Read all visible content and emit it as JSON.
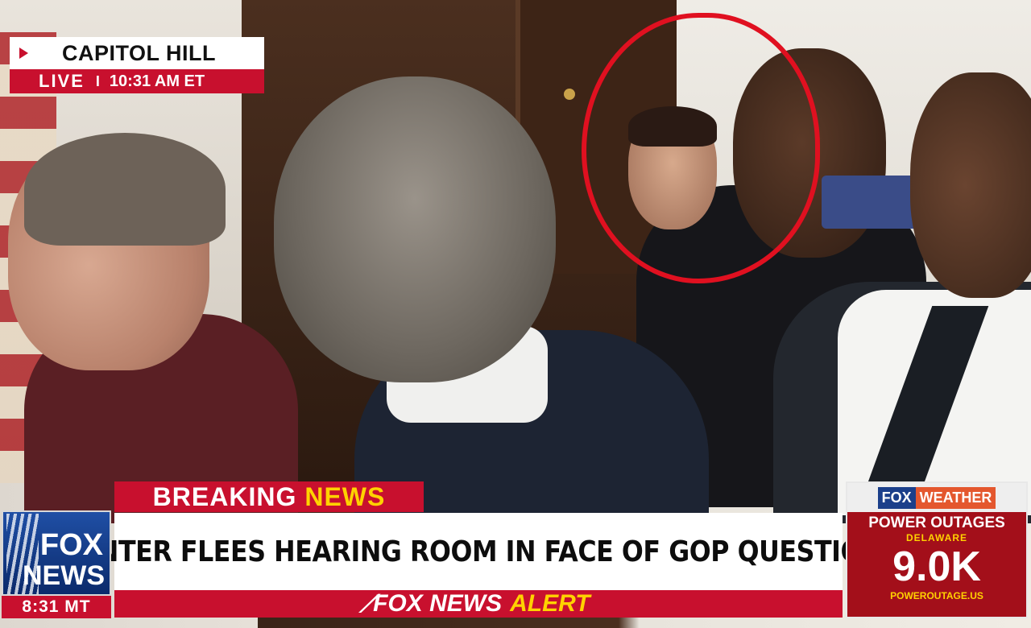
{
  "location_bug": {
    "title": "CAPITOL HILL",
    "live_label": "LIVE",
    "separator": "I",
    "time": "10:31 AM ET"
  },
  "lower_third": {
    "breaking_word1": "BREAKING",
    "breaking_word2": "NEWS",
    "headline": "HUNTER FLEES HEARING ROOM IN FACE OF GOP QUESTIONS",
    "alert_brand": "FOX NEWS",
    "alert_word": "ALERT"
  },
  "network_logo": {
    "line1": "FOX",
    "line2": "NEWS",
    "local_time": "8:31 MT"
  },
  "weather_panel": {
    "brand1": "FOX",
    "brand2": "WEATHER",
    "title": "POWER OUTAGES",
    "region": "DELAWARE",
    "value": "9.0K",
    "source": "POWEROUTAGE.US"
  },
  "colors": {
    "accent_red": "#c8102e",
    "accent_yellow": "#ffd200",
    "brand_blue": "#1f4fa5",
    "annotation_circle": "#e01020"
  }
}
